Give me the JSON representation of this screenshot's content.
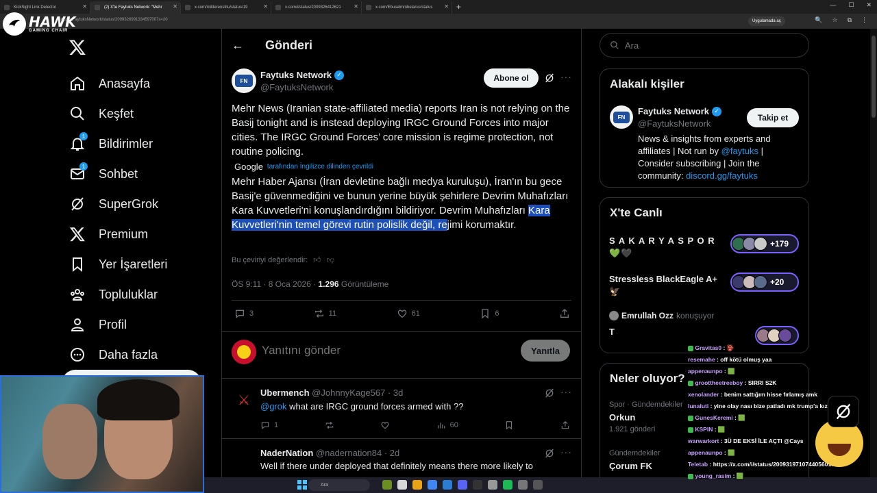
{
  "browser": {
    "tabs": [
      {
        "label": "KickSight Link Detector",
        "active": false
      },
      {
        "label": "(2) X'te Faytuks Network: \"Mehr",
        "active": true
      },
      {
        "label": "x.com/militerenstitu/status/19",
        "active": false
      },
      {
        "label": "x.com/i/status/2009326412621",
        "active": false
      },
      {
        "label": "x.com/Ebuselmmbelarus/status",
        "active": false
      }
    ],
    "url": "x.com/FaytuksNetwork/status/2009326991334597007s=20",
    "open_in_app": "Uygulamada aç"
  },
  "overlay": {
    "brand": "HAWK",
    "brand_sub": "GAMING CHAIR"
  },
  "sidebar": {
    "items": [
      {
        "label": "Anasayfa",
        "icon": "home-icon"
      },
      {
        "label": "Keşfet",
        "icon": "search-icon"
      },
      {
        "label": "Bildirimler",
        "icon": "bell-icon",
        "badge": "1"
      },
      {
        "label": "Sohbet",
        "icon": "mail-icon",
        "badge": "1"
      },
      {
        "label": "SuperGrok",
        "icon": "grok-icon"
      },
      {
        "label": "Premium",
        "icon": "x-icon"
      },
      {
        "label": "Yer İşaretleri",
        "icon": "bookmark-icon"
      },
      {
        "label": "Topluluklar",
        "icon": "communities-icon"
      },
      {
        "label": "Profil",
        "icon": "profile-icon"
      },
      {
        "label": "Daha fazla",
        "icon": "more-circle-icon"
      }
    ]
  },
  "header": {
    "title": "Gönderi"
  },
  "post": {
    "author_name": "Faytuks Network",
    "author_handle": "@FaytuksNetwork",
    "subscribe_label": "Abone ol",
    "text_original": "Mehr News (Iranian state-affiliated media) reports Iran is not relying on the Basij tonight and is instead deploying IRGC Ground Forces into major cities. The IRGC Ground Forces’ core mission is regime protection, not routine policing.",
    "google_label": "Google",
    "translated_note": "tarafından İngilizce dilinden çevrildi",
    "text_tr_before": "Mehr Haber Ajansı (İran devletine bağlı medya kuruluşu), İran'ın bu gece Basij'e güvenmediğini ve bunun yerine büyük şehirlere Devrim Muhafızları Kara Kuvvetleri'ni konuşlandırdığını bildiriyor. Devrim Muhafızları ",
    "text_tr_highlight": "Kara Kuvvetleri'nin temel görevi rutin polislik değil, re",
    "text_tr_after": "jimi korumaktır.",
    "rate_label": "Bu çeviriyi değerlendir:",
    "time": "ÖS 9:11 · 8 Oca 2026 · ",
    "views": "1.296",
    "views_label": " Görüntüleme",
    "replies": "3",
    "reposts": "11",
    "likes": "61",
    "bookmarks": "6"
  },
  "reply_box": {
    "placeholder": "Yanıtını gönder",
    "button": "Yanıtla"
  },
  "comments": [
    {
      "name": "Ubermench",
      "handle": "@JohnnyKage567 · 3d",
      "mention": "@grok",
      "text": " what are IRGC ground forces armed with ??",
      "replies": "1",
      "views": "60"
    },
    {
      "name": "NaderNation",
      "handle": "@nadernation84 · 2d",
      "text": "Well if there under deployed that definitely means there more likely to"
    }
  ],
  "right": {
    "search_placeholder": "Ara",
    "related_title": "Alakalı kişiler",
    "related": {
      "name": "Faytuks Network",
      "handle": "@FaytuksNetwork",
      "follow_label": "Takip et",
      "bio_1": "News & insights from experts and affiliates | Not run by ",
      "bio_mention": "@faytuks",
      "bio_2": " | Consider subscribing | Join the community: ",
      "bio_link": "discord.gg/faytuks"
    },
    "live_title": "X'te Canlı",
    "live": [
      {
        "title": "S A K A R Y A S P O R 💚🖤",
        "count": "+179"
      },
      {
        "title": "Stressless BlackEagle A+ 🦅",
        "count": "+20"
      }
    ],
    "speaker": "Emrullah Ozz",
    "speaker_status": "konuşuyor",
    "speaker_letter": "T",
    "trends_title": "Neler oluyor?",
    "trends": [
      {
        "category": "Spor · Gündemdekiler",
        "name": "Orkun",
        "count": "1.921 gönderi"
      },
      {
        "category": "Gündemdekiler",
        "name": "Çorum FK",
        "count": ""
      }
    ]
  },
  "chat": [
    {
      "user": "Gravitas0",
      "msg": ": 👺"
    },
    {
      "user": "resemahe",
      "msg": ": off kötü olmuş yaa"
    },
    {
      "user": "appenaunpo",
      "msg": ": 🟩"
    },
    {
      "user": "groottheetreeboy",
      "msg": ": SIRRI S2K"
    },
    {
      "user": "xenolander",
      "msg": ": benim sattığım hisse fırlamış amk"
    },
    {
      "user": "lunaluti",
      "msg": ": yine olay nası bize patladı mk trump'a kız"
    },
    {
      "user": "GunesKeremi",
      "msg": ": 🟩"
    },
    {
      "user": "KSPIN",
      "msg": ": 🟩"
    },
    {
      "user": "warwarkort",
      "msg": ": 3Ü DE EKSİ İLE AÇTI @Cays"
    },
    {
      "user": "appenaunpo",
      "msg": ": 🟩"
    },
    {
      "user": "Teletab",
      "msg": ": https://x.com/i/status/2009319710744056010"
    },
    {
      "user": "young_rasim",
      "msg": ": 🟩"
    }
  ],
  "taskbar": {
    "search": "Ara"
  }
}
